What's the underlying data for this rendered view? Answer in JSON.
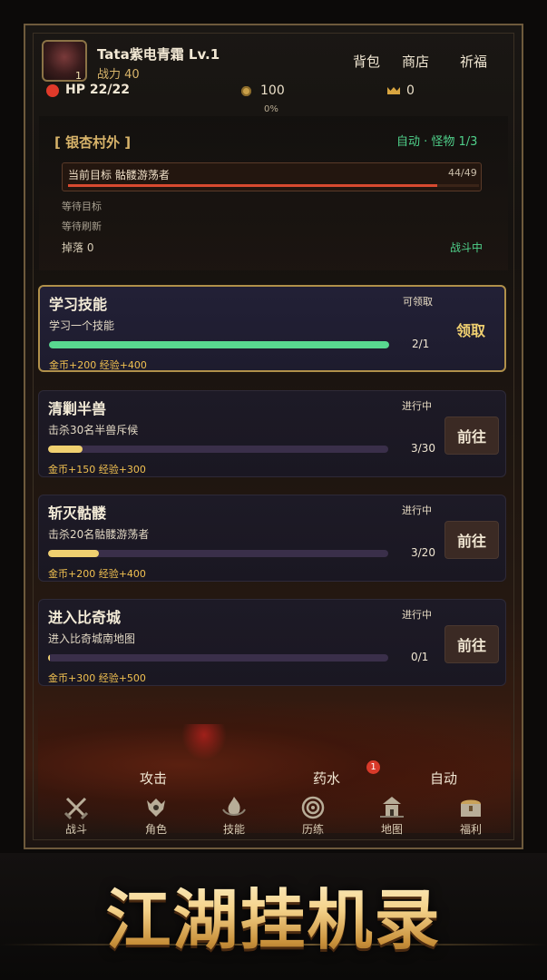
{
  "player": {
    "name_level": "Tata紫电青霜  Lv.1",
    "power": "战力 40",
    "avatar_level": "1",
    "hp": "HP 22/22",
    "coins": "100",
    "gems": "0",
    "xp_percent": "0%"
  },
  "top_nav": {
    "bag": "背包",
    "shop": "商店",
    "pray": "祈福"
  },
  "battle": {
    "location": "[ 银杏村外 ]",
    "status": "自动 · 怪物 1/3",
    "target_label": "当前目标  骷髅游荡者",
    "target_hp": "44/49",
    "target_hp_fraction": 0.898,
    "waiting_target": "等待目标",
    "waiting_refresh": "等待刷新",
    "drops": "掉落 0",
    "combat_state": "战斗中"
  },
  "quests": [
    {
      "title": "学习技能",
      "state": "可领取",
      "desc": "学习一个技能",
      "count": "2/1",
      "progress": 1.0,
      "reward": "金币+200  经验+400",
      "button": "领取"
    },
    {
      "title": "清剿半兽",
      "state": "进行中",
      "desc": "击杀30名半兽斥候",
      "count": "3/30",
      "progress": 0.1,
      "reward": "金币+150  经验+300",
      "button": "前往"
    },
    {
      "title": "斩灭骷髅",
      "state": "进行中",
      "desc": "击杀20名骷髅游荡者",
      "count": "3/20",
      "progress": 0.15,
      "reward": "金币+200  经验+400",
      "button": "前往"
    },
    {
      "title": "进入比奇城",
      "state": "进行中",
      "desc": "进入比奇城南地图",
      "count": "0/1",
      "progress": 0.0,
      "reward": "金币+300  经验+500",
      "button": "前往"
    }
  ],
  "actions": {
    "attack": "攻击",
    "potion": "药水",
    "potion_badge": "1",
    "auto": "自动"
  },
  "tabs": [
    {
      "label": "战斗",
      "icon": "crossed-swords-icon"
    },
    {
      "label": "角色",
      "icon": "character-icon"
    },
    {
      "label": "技能",
      "icon": "skill-flame-icon"
    },
    {
      "label": "历练",
      "icon": "swirl-icon"
    },
    {
      "label": "地图",
      "icon": "map-building-icon"
    },
    {
      "label": "福利",
      "icon": "treasure-chest-icon"
    }
  ],
  "banner": {
    "title": "江湖挂机录"
  },
  "colors": {
    "gold": "#d8b46a",
    "green": "#4fd08a",
    "hp_red": "#d84a30",
    "progress_yellow": "#f0d070",
    "progress_green": "#58d890"
  }
}
